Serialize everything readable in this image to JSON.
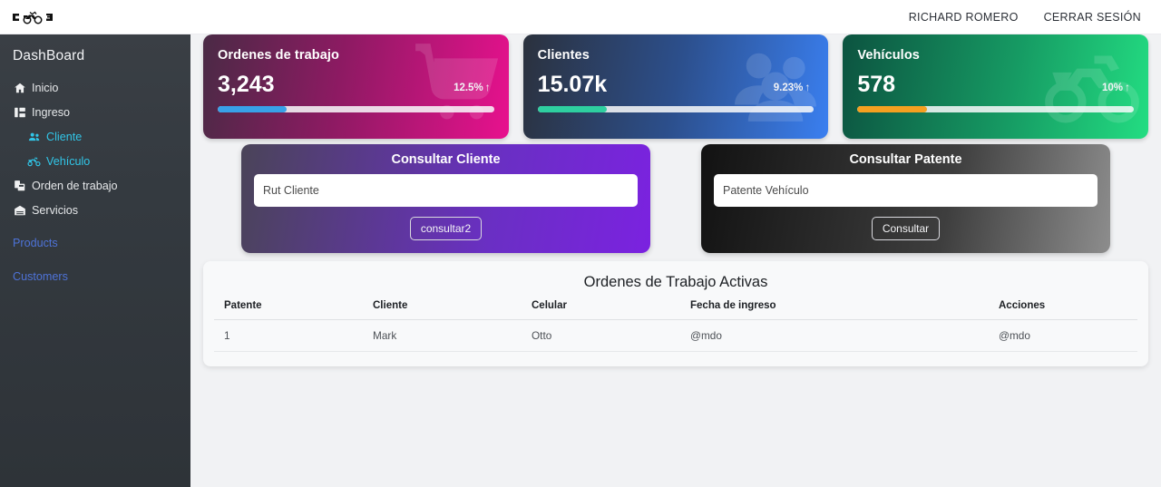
{
  "topbar": {
    "logo_name": "motorcycle-logo",
    "user_name": "RICHARD ROMERO",
    "logout_label": "CERRAR SESIÓN"
  },
  "sidebar": {
    "title": "DashBoard",
    "items": [
      {
        "label": "Inicio",
        "icon": "home-icon",
        "level": "top"
      },
      {
        "label": "Ingreso",
        "icon": "sitemap-icon",
        "level": "top"
      },
      {
        "label": "Cliente",
        "icon": "users-icon",
        "level": "sub"
      },
      {
        "label": "Vehículo",
        "icon": "motorcycle-icon",
        "level": "sub"
      },
      {
        "label": "Orden de trabajo",
        "icon": "clipboard-icon",
        "level": "top"
      },
      {
        "label": "Servicios",
        "icon": "garage-icon",
        "level": "top"
      }
    ],
    "links": [
      {
        "label": "Products"
      },
      {
        "label": "Customers"
      }
    ],
    "link_color": "#4e73d8",
    "sub_color": "#31c6e8"
  },
  "stats": [
    {
      "title": "Ordenes de trabajo",
      "value": "3,243",
      "delta": "12.5%",
      "arrow": "↑",
      "progress_percent": 25,
      "progress_color": "#38a1e8",
      "icon": "shopping-cart-icon",
      "gradient_from": "#4a2a45",
      "gradient_to": "#e8118e"
    },
    {
      "title": "Clientes",
      "value": "15.07k",
      "delta": "9.23%",
      "arrow": "↑",
      "progress_percent": 25,
      "progress_color": "#2ecfa0",
      "icon": "users-group-icon",
      "gradient_from": "#2b313d",
      "gradient_to": "#3a7ff0"
    },
    {
      "title": "Vehículos",
      "value": "578",
      "delta": "10%",
      "arrow": "↑",
      "progress_percent": 25,
      "progress_color": "#f5a020",
      "icon": "motorcycle-icon",
      "gradient_from": "#0c5340",
      "gradient_to": "#23dd82"
    }
  ],
  "consult": [
    {
      "title": "Consultar Cliente",
      "placeholder": "Rut Cliente",
      "value": "",
      "button_label": "consultar2"
    },
    {
      "title": "Consultar Patente",
      "placeholder": "Patente Vehículo",
      "value": "",
      "button_label": "Consultar"
    }
  ],
  "table": {
    "title": "Ordenes de Trabajo Activas",
    "headers": [
      "Patente",
      "Cliente",
      "Celular",
      "Fecha de ingreso",
      "Acciones"
    ],
    "rows": [
      [
        "1",
        "Mark",
        "Otto",
        "@mdo",
        "@mdo"
      ]
    ]
  }
}
